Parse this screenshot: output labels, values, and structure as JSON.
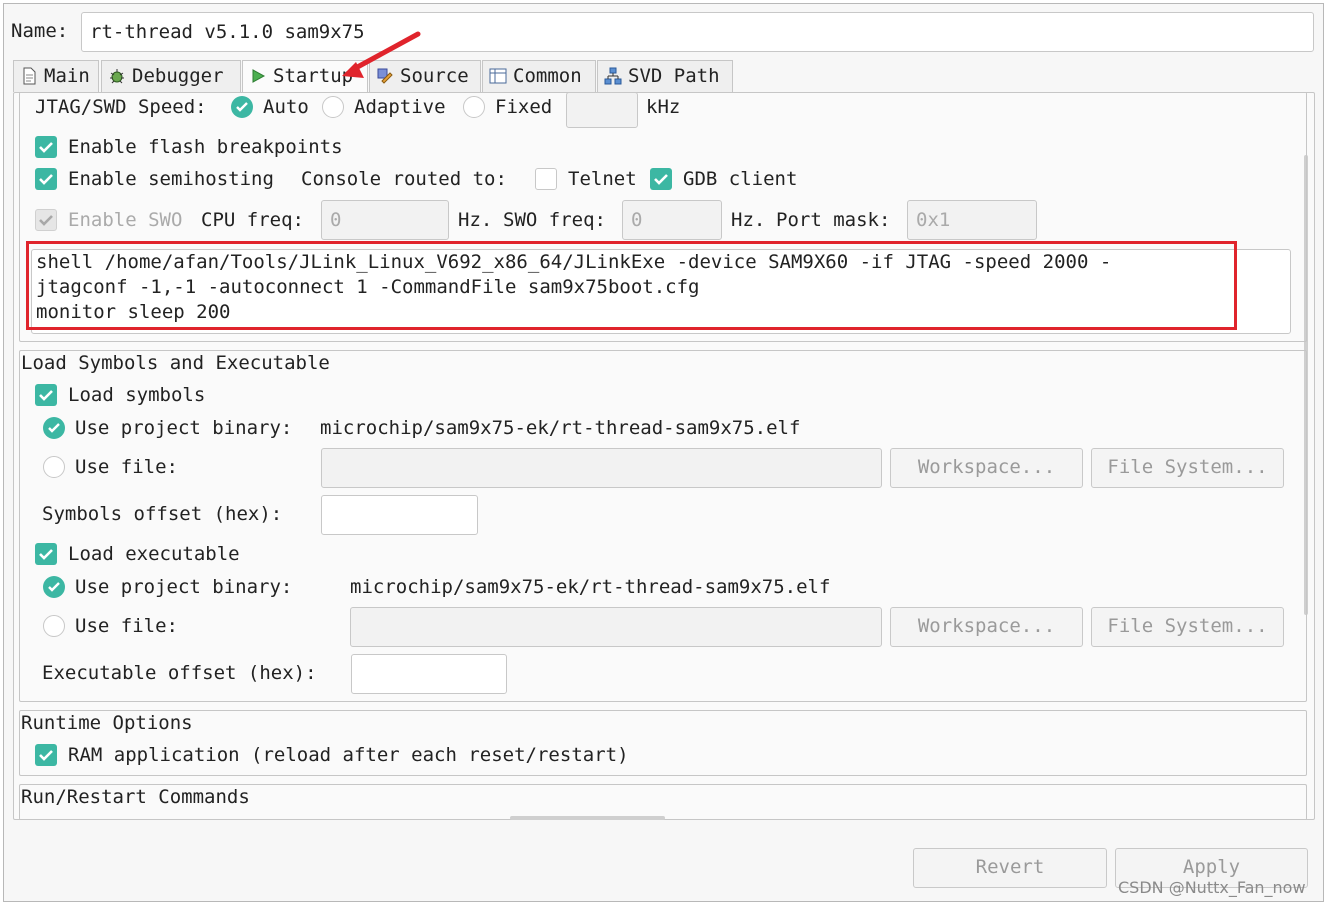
{
  "name_label": "Name:",
  "name_value": "rt-thread v5.1.0 sam9x75",
  "tabs": [
    {
      "label": "Main",
      "icon": "document-icon"
    },
    {
      "label": "Debugger",
      "icon": "debugger-bug-icon"
    },
    {
      "label": "Startup",
      "icon": "play-icon"
    },
    {
      "label": "Source",
      "icon": "source-icon"
    },
    {
      "label": "Common",
      "icon": "table-icon"
    },
    {
      "label": "SVD Path",
      "icon": "tree-icon"
    }
  ],
  "jtag": {
    "label": "JTAG/SWD Speed:",
    "auto": "Auto",
    "adaptive": "Adaptive",
    "fixed": "Fixed",
    "unit": "kHz",
    "fixed_value": ""
  },
  "flash_breakpoints": "Enable flash breakpoints",
  "semihosting": {
    "label": "Enable semihosting",
    "console_label": "Console routed to:",
    "telnet": "Telnet",
    "gdb": "GDB client"
  },
  "swo": {
    "label": "Enable SWO",
    "cpu_label": "CPU freq:",
    "cpu_value": "0",
    "hz1": "Hz.",
    "swo_label": "SWO freq:",
    "swo_value": "0",
    "hz2": "Hz.",
    "port_label": "Port mask:",
    "port_value": "0x1"
  },
  "init_commands": {
    "line1": "shell /home/afan/Tools/JLink_Linux_V692_x86_64/JLinkExe -device SAM9X60 -if JTAG -speed 2000 -",
    "line2": "jtagconf -1,-1 -autoconnect 1 -CommandFile sam9x75boot.cfg",
    "line3": "monitor sleep 200"
  },
  "load_section": {
    "title": "Load Symbols and Executable",
    "load_symbols": "Load symbols",
    "use_project_binary": "Use project binary:",
    "symbols_binary": "microchip/sam9x75-ek/rt-thread-sam9x75.elf",
    "use_file": "Use file:",
    "workspace": "Workspace...",
    "file_system": "File System...",
    "symbols_offset": "Symbols offset (hex):",
    "load_executable": "Load executable",
    "use_project_binary_exec": "Use project binary:",
    "exec_binary": "microchip/sam9x75-ek/rt-thread-sam9x75.elf",
    "use_file_exec": "Use file:",
    "workspace2": "Workspace...",
    "file_system2": "File System...",
    "exec_offset": "Executable offset (hex):"
  },
  "runtime": {
    "title": "Runtime Options",
    "ram_app": "RAM application (reload after each reset/restart)"
  },
  "run_restart": {
    "title": "Run/Restart Commands"
  },
  "buttons": {
    "revert": "Revert",
    "apply": "Apply"
  },
  "watermark": "CSDN @Nuttx_Fan_now",
  "colors": {
    "accent": "#3cb7a3",
    "highlight": "#e0242c",
    "arrow": "#e0242c"
  }
}
